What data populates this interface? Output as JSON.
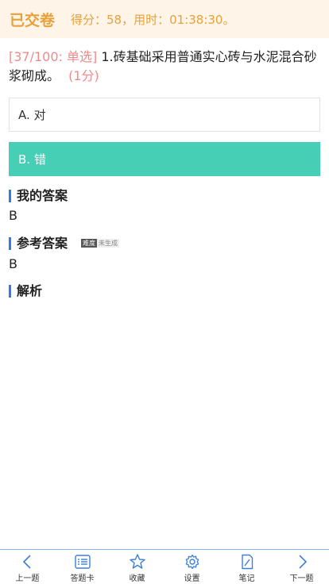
{
  "header": {
    "status": "已交卷",
    "score_text": "得分：58，用时：01:38:30。"
  },
  "question": {
    "meta": "[37/100: 单选]",
    "text": "1.砖基础采用普通实心砖与水泥混合砂浆砌成。",
    "points": "(1分)"
  },
  "options": [
    {
      "label": "A. 对",
      "selected": false
    },
    {
      "label": "B. 错",
      "selected": true
    }
  ],
  "my_answer": {
    "title": "我的答案",
    "value": "B"
  },
  "reference_answer": {
    "title": "参考答案",
    "difficulty_label": "难度",
    "difficulty_value": "未生成",
    "value": "B"
  },
  "analysis": {
    "title": "解析"
  },
  "bottom_nav": [
    {
      "label": "上一题",
      "icon": "chevron-left-icon"
    },
    {
      "label": "答题卡",
      "icon": "list-icon"
    },
    {
      "label": "收藏",
      "icon": "star-icon"
    },
    {
      "label": "设置",
      "icon": "gear-icon"
    },
    {
      "label": "笔记",
      "icon": "note-icon"
    },
    {
      "label": "下一题",
      "icon": "chevron-right-icon"
    }
  ],
  "colors": {
    "accent_orange": "#e8a13a",
    "selected_option": "#47cfb6",
    "section_bar": "#2f7de1",
    "icon_blue": "#3a7fd8"
  }
}
